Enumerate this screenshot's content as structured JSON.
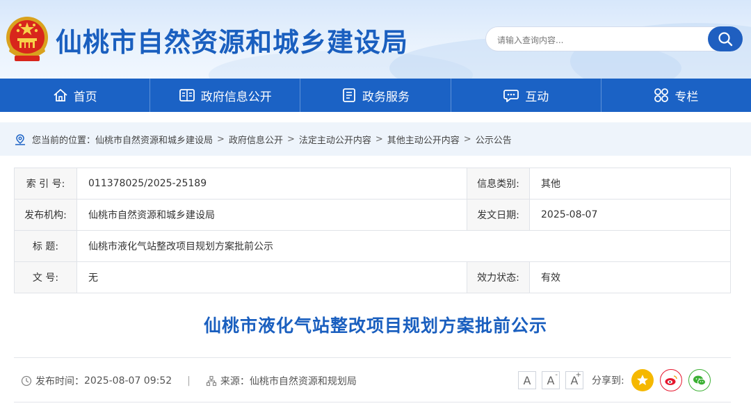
{
  "header": {
    "site_title": "仙桃市自然资源和城乡建设局",
    "search_placeholder": "请输入查询内容...",
    "emblem_icon": "national-emblem-icon"
  },
  "nav": {
    "items": [
      {
        "label": "首页",
        "icon": "home-icon"
      },
      {
        "label": "政府信息公开",
        "icon": "document-list-icon"
      },
      {
        "label": "政务服务",
        "icon": "service-doc-icon"
      },
      {
        "label": "互动",
        "icon": "chat-icon"
      },
      {
        "label": "专栏",
        "icon": "grid-icon"
      }
    ]
  },
  "breadcrumb": {
    "prefix": "您当前的位置：",
    "items": [
      "仙桃市自然资源和城乡建设局",
      "政府信息公开",
      "法定主动公开内容",
      "其他主动公开内容",
      "公示公告"
    ],
    "separator": ">"
  },
  "info_table": {
    "index_label": "索 引 号:",
    "index_value": "011378025/2025-25189",
    "category_label": "信息类别:",
    "category_value": "其他",
    "issuer_label": "发布机构:",
    "issuer_value": "仙桃市自然资源和城乡建设局",
    "date_label": "发文日期:",
    "date_value": "2025-08-07",
    "title_label": "标 题:",
    "title_value": "仙桃市液化气站整改项目规划方案批前公示",
    "docno_label": "文 号:",
    "docno_value": "无",
    "status_label": "效力状态:",
    "status_value": "有效"
  },
  "article": {
    "title": "仙桃市液化气站整改项目规划方案批前公示",
    "publish_label": "发布时间：",
    "publish_time": "2025-08-07 09:52",
    "divider": "|",
    "source_label": "来源：",
    "source_value": "仙桃市自然资源和规划局",
    "font_small": "A",
    "font_minus": "A",
    "font_minus_sup": "-",
    "font_plus": "A",
    "font_plus_sup": "+",
    "share_label": "分享到:"
  },
  "colors": {
    "brand": "#1b62c5",
    "title_blue": "#1a5fbf",
    "qzone": "#f5b800",
    "weibo": "#e6162d",
    "wechat": "#3cb034"
  }
}
